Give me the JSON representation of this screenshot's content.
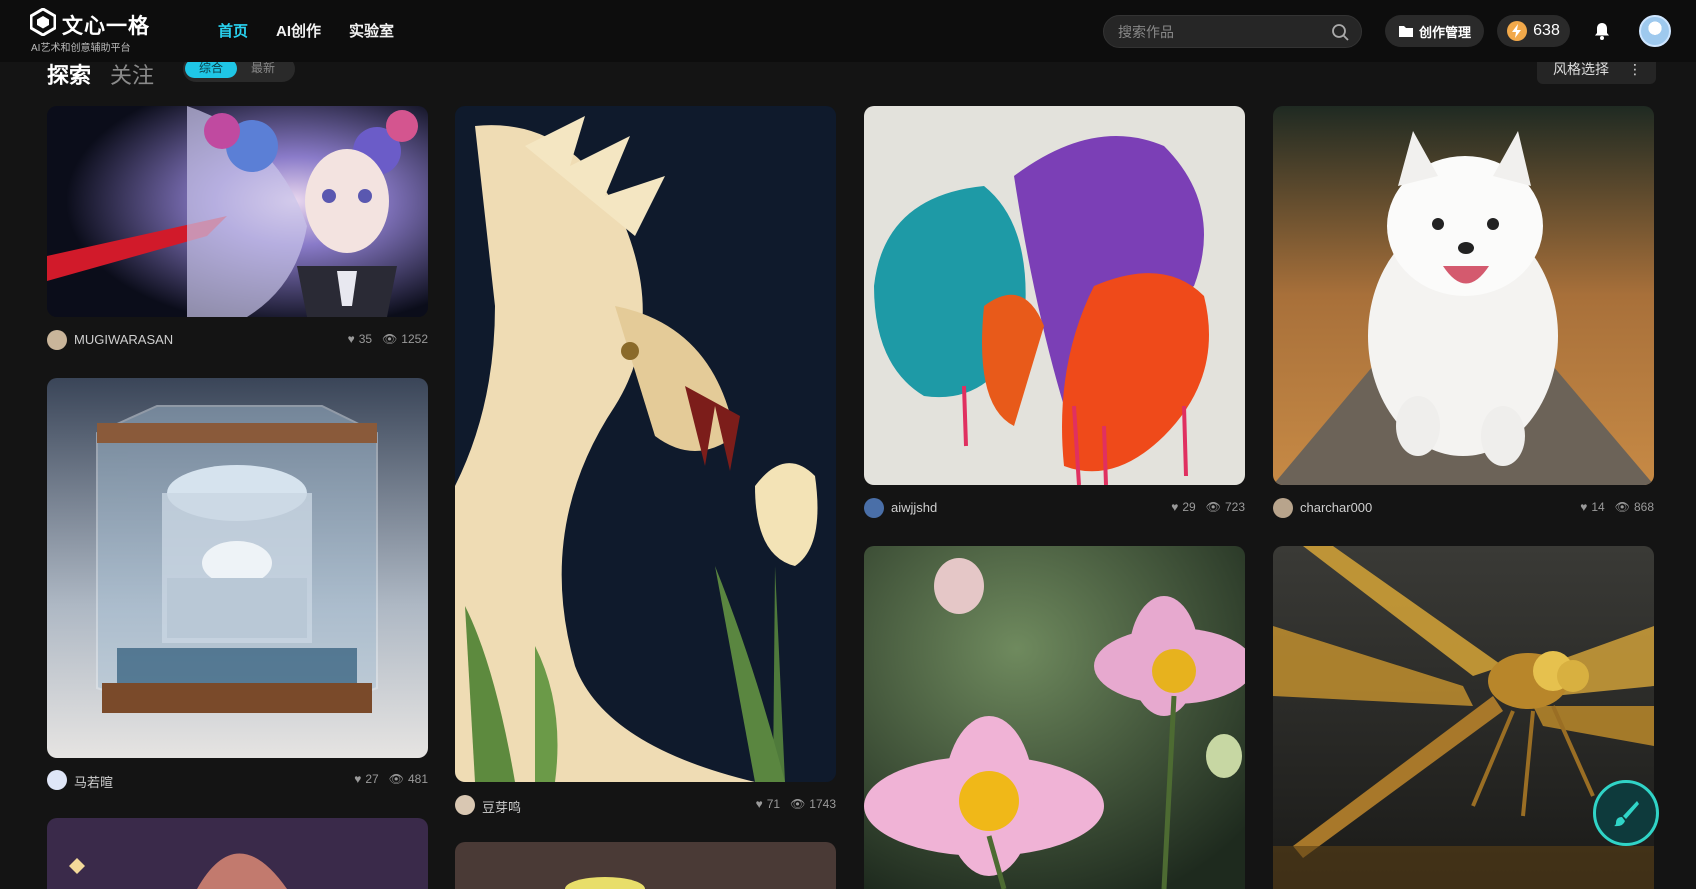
{
  "app": {
    "title": "文心一格",
    "subtitle": "AI艺术和创意辅助平台"
  },
  "nav": [
    {
      "label": "首页",
      "active": true
    },
    {
      "label": "AI创作",
      "active": false
    },
    {
      "label": "实验室",
      "active": false
    }
  ],
  "search": {
    "placeholder": "搜索作品",
    "value": ""
  },
  "header_actions": {
    "manage_label": "创作管理",
    "points": "638"
  },
  "sub_tabs": {
    "explore": "探索",
    "follow": "关注"
  },
  "sort_pills": {
    "selected": "综合",
    "other": "最新"
  },
  "style_select": {
    "label": "风格选择"
  },
  "colors": {
    "accent": "#29d2f0",
    "background": "#141414",
    "fab_ring": "#30d4c7"
  },
  "cards": [
    {
      "subject": "anime-girl",
      "author": "MUGIWARASAN",
      "likes": "35",
      "views": "1252"
    },
    {
      "subject": "crystal-palace",
      "author": "马若暄",
      "likes": "27",
      "views": "481"
    },
    {
      "subject": "ivory-dragon",
      "author": "豆芽鸣",
      "likes": "71",
      "views": "1743"
    },
    {
      "subject": "ink-explosion",
      "author": "aiwjjshd",
      "likes": "29",
      "views": "723"
    },
    {
      "subject": "samoyed-puppy",
      "author": "charchar000",
      "likes": "14",
      "views": "868"
    },
    {
      "subject": "pink-daisies",
      "author": "",
      "likes": "",
      "views": ""
    },
    {
      "subject": "golden-dragonfly",
      "author": "",
      "likes": "",
      "views": ""
    }
  ]
}
